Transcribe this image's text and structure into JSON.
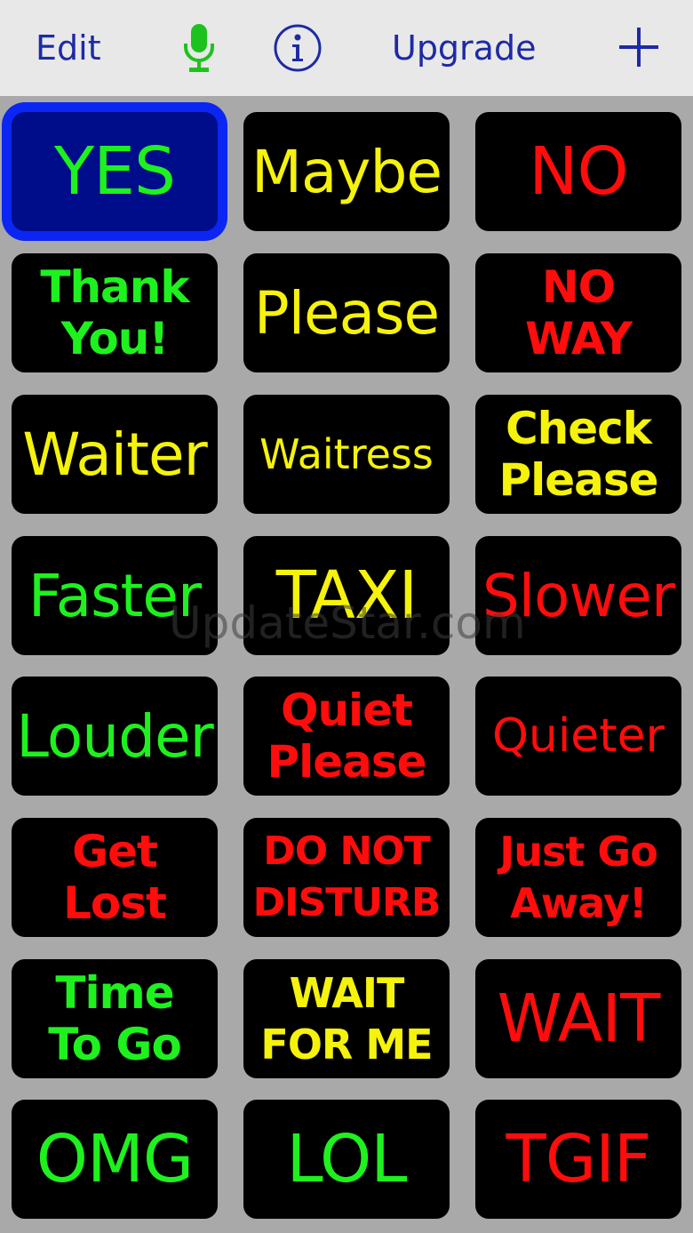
{
  "toolbar": {
    "edit_label": "Edit",
    "upgrade_label": "Upgrade",
    "mic_icon": "microphone-icon",
    "info_icon": "info-icon",
    "add_icon": "plus-icon",
    "accent_color": "#1d2aa6",
    "mic_color": "#1ec21e"
  },
  "colors": {
    "green": "#1ef11e",
    "yellow": "#f5f20c",
    "red": "#ff0c0c",
    "selected_bg": "#000d8a",
    "selected_border": "#0b26f2",
    "tile_bg": "#000000",
    "page_bg": "#a9a9a9"
  },
  "tiles": [
    {
      "text": "YES",
      "color": "green",
      "selected": true
    },
    {
      "text": "Maybe",
      "color": "yellow"
    },
    {
      "text": "NO",
      "color": "red"
    },
    {
      "text": "Thank\nYou!",
      "color": "green"
    },
    {
      "text": "Please",
      "color": "yellow"
    },
    {
      "text": "NO\nWAY",
      "color": "red"
    },
    {
      "text": "Waiter",
      "color": "yellow"
    },
    {
      "text": "Waitress",
      "color": "yellow"
    },
    {
      "text": "Check\nPlease",
      "color": "yellow"
    },
    {
      "text": "Faster",
      "color": "green"
    },
    {
      "text": "TAXI",
      "color": "yellow"
    },
    {
      "text": "Slower",
      "color": "red"
    },
    {
      "text": "Louder",
      "color": "green"
    },
    {
      "text": "Quiet\nPlease",
      "color": "red"
    },
    {
      "text": "Quieter",
      "color": "red"
    },
    {
      "text": "Get\nLost",
      "color": "red"
    },
    {
      "text": "DO NOT\nDISTURB",
      "color": "red"
    },
    {
      "text": "Just Go\nAway!",
      "color": "red"
    },
    {
      "text": "Time\nTo Go",
      "color": "green"
    },
    {
      "text": "WAIT\nFOR ME",
      "color": "yellow"
    },
    {
      "text": "WAIT",
      "color": "red"
    },
    {
      "text": "OMG",
      "color": "green"
    },
    {
      "text": "LOL",
      "color": "green"
    },
    {
      "text": "TGIF",
      "color": "red"
    }
  ],
  "watermark": "UpdateStar.com"
}
